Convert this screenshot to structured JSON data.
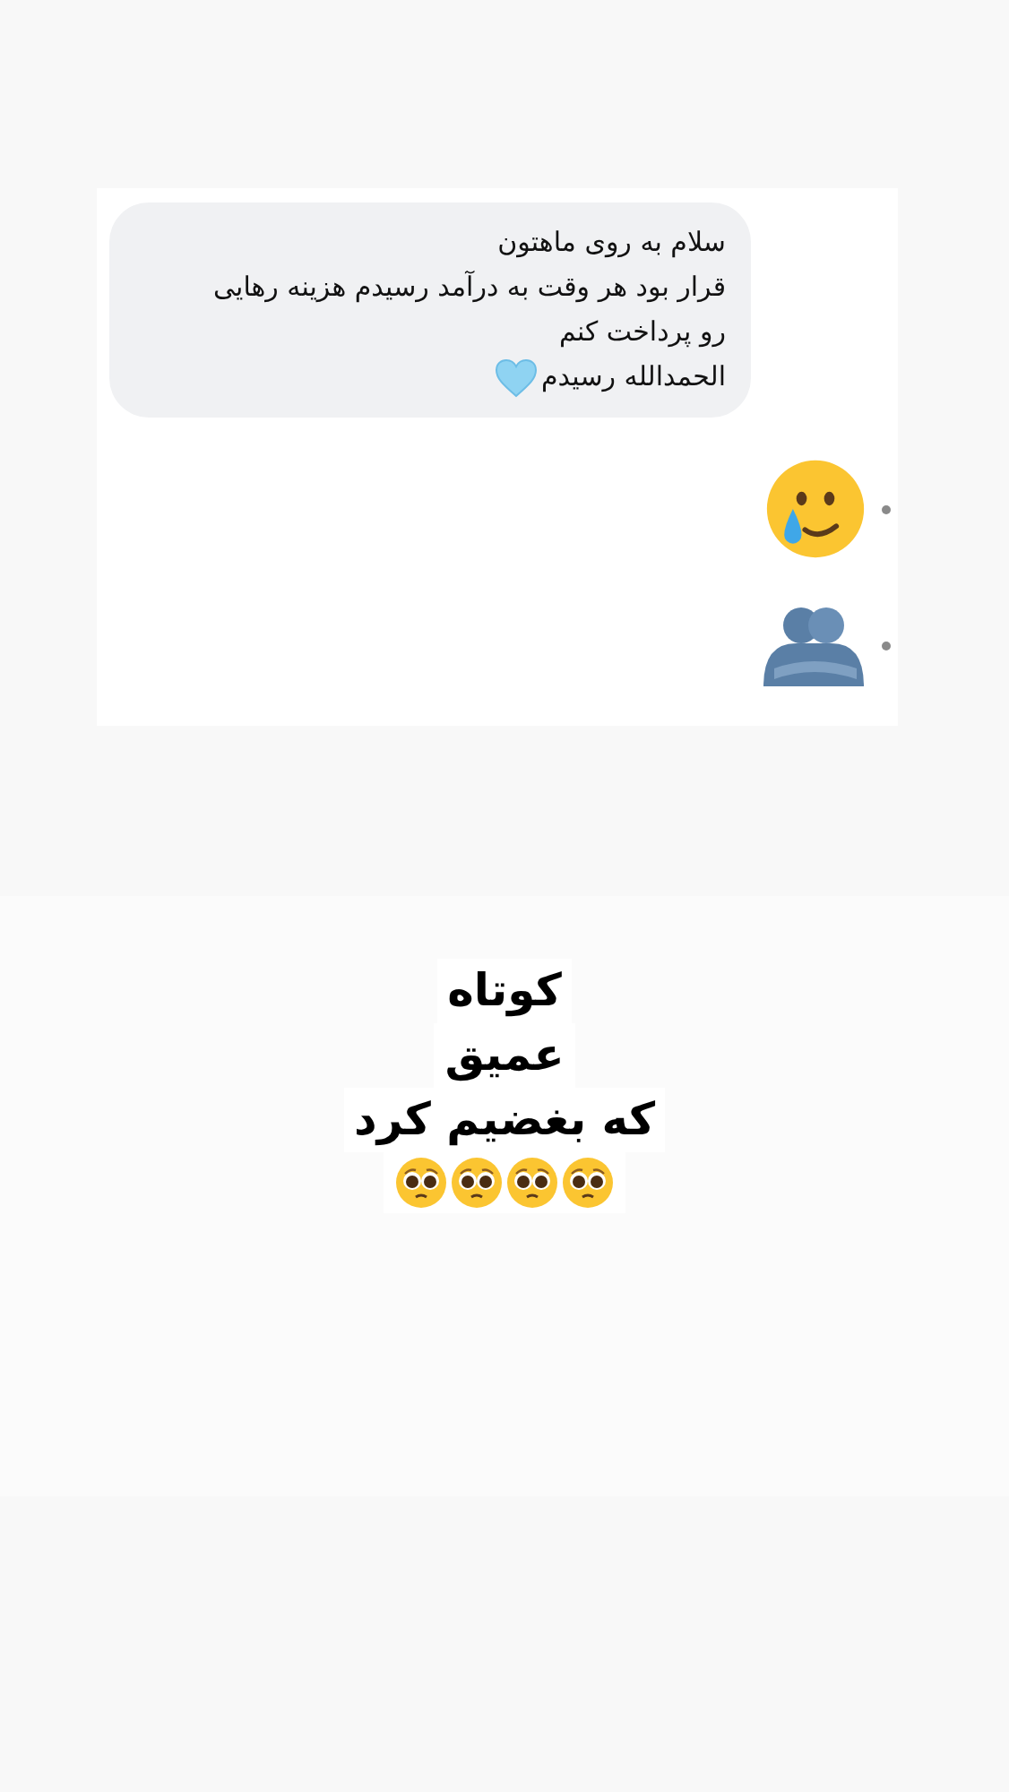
{
  "message": {
    "lines": [
      "سلام به روی ماهتون",
      "قرار بود هر وقت به درآمد رسیدم هزینه رهایی",
      "رو پرداخت کنم",
      "الحمدالله رسیدم"
    ],
    "end_emoji": {
      "kind": "heart"
    }
  },
  "reactions": [
    {
      "kind": "crying-smile"
    },
    {
      "kind": "hug"
    }
  ],
  "caption": {
    "lines": [
      "کوتاه",
      "عمیق",
      "که بغضیم کرد"
    ],
    "emojis": [
      {
        "kind": "pleading"
      },
      {
        "kind": "pleading"
      },
      {
        "kind": "pleading"
      },
      {
        "kind": "pleading"
      }
    ]
  }
}
